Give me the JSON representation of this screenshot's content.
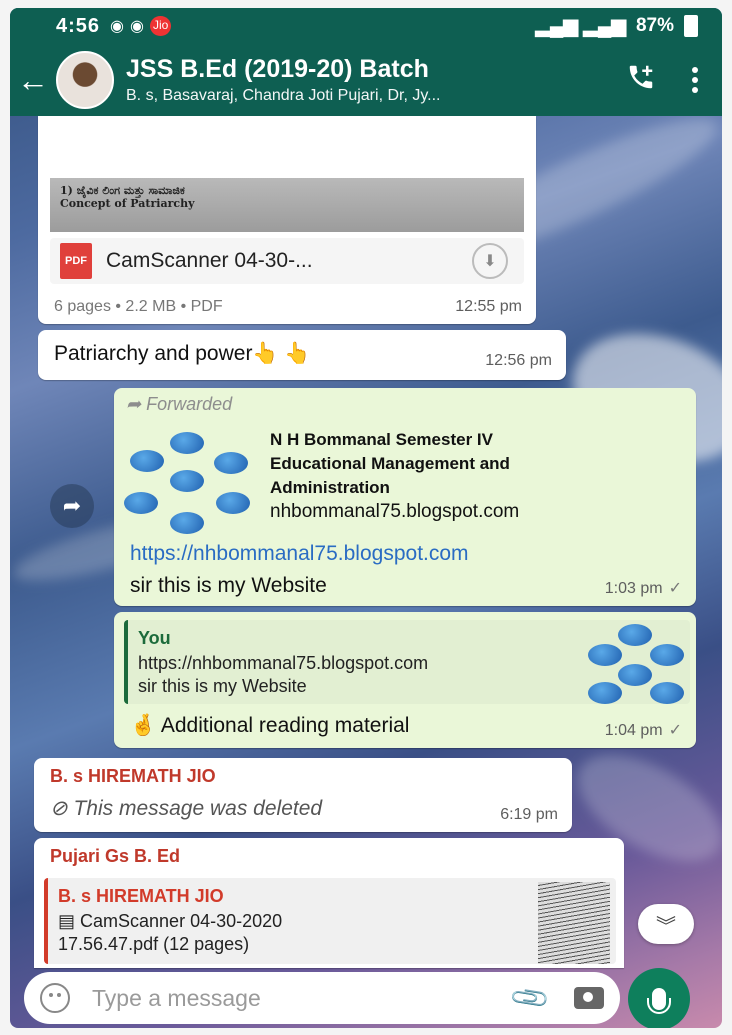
{
  "status_bar": {
    "time": "4:56",
    "carrier": "Jio",
    "battery": "87%"
  },
  "header": {
    "title": "JSS B.Ed (2019-20) Batch",
    "subtitle": "B. s, Basavaraj, Chandra Joti Pujari, Dr, Jy...",
    "icons": [
      "back-arrow-icon",
      "add-call-icon",
      "menu-dots-icon"
    ]
  },
  "messages": {
    "doc1": {
      "thumb_lines": [
        "1) ಜೈವಿಕ ಲಿಂಗ ಮತ್ತು ಸಾಮಾಜಿಕ",
        "Concept of Patriarchy"
      ],
      "name": "CamScanner 04-30-...",
      "info": "6 pages • 2.2 MB • PDF",
      "time": "12:55 pm"
    },
    "text1": {
      "text": "Patriarchy and power👆 👆",
      "time": "12:56 pm"
    },
    "forwarded": {
      "label": "Forwarded",
      "preview_title_1": "N H Bommanal Semester IV",
      "preview_title_2": "Educational Management and",
      "preview_title_3": "Administration",
      "preview_domain": "nhbommanal75.blogspot.com",
      "link": "https://nhbommanal75.blogspot.com",
      "text": "sir this is my Website",
      "time": "1:03 pm",
      "tick": "✓"
    },
    "reply": {
      "quote_name": "You",
      "quote_line1": "https://nhbommanal75.blogspot.com",
      "quote_line2": "sir this is my Website",
      "text": "🤞 Additional reading material",
      "time": "1:04 pm",
      "tick": "✓"
    },
    "deleted": {
      "sender": "B. s HIREMATH JIO",
      "text": "This message was deleted",
      "time": "6:19 pm",
      "sender_color": "#c0392b"
    },
    "forward_doc": {
      "sender": "Pujari Gs B. Ed",
      "quote_name": "B. s HIREMATH JIO",
      "quote_line1": "CamScanner 04-30-2020",
      "quote_line2": "17.56.47.pdf (12 pages)",
      "sender_color": "#c0392b"
    }
  },
  "input": {
    "placeholder": "Type a message"
  },
  "colors": {
    "header": "#0e5f52",
    "outgoing_bubble": "#eaf7d8",
    "link": "#2a6cc3",
    "mic": "#0e7f5c"
  }
}
